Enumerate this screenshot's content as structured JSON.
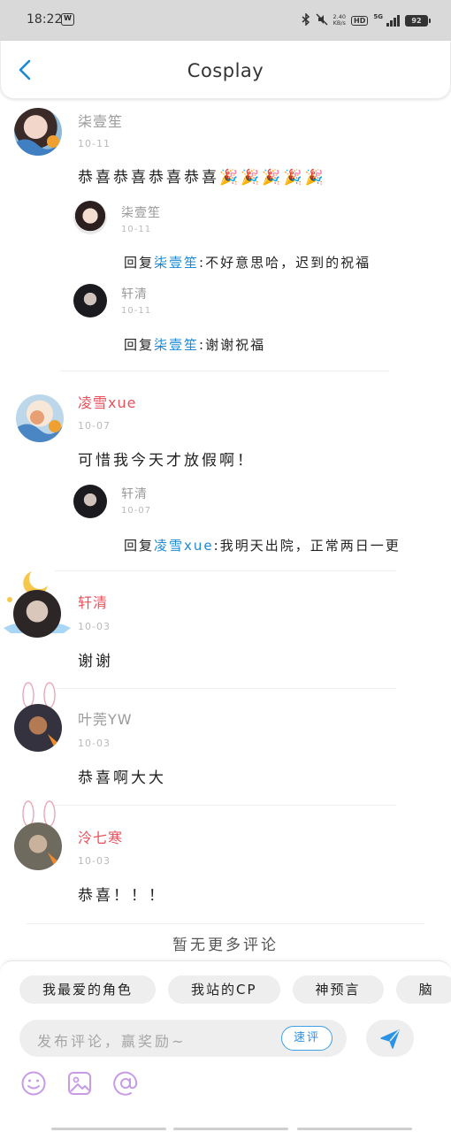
{
  "status_bar": {
    "time": "18:22",
    "app_badge": "W",
    "net_speed_value": "2.40",
    "net_speed_unit": "KB/s",
    "hd": "HD",
    "fiveg": "5G",
    "battery": "92"
  },
  "header": {
    "title": "Cosplay"
  },
  "comments": [
    {
      "name": "柒壹笙",
      "name_color": "gray",
      "date": "10-11",
      "text": "恭喜恭喜恭喜恭喜🎉🎉🎉🎉🎉",
      "replies": [
        {
          "name": "柒壹笙",
          "date": "10-11",
          "prefix": "回复",
          "mention": "柒壹笙",
          "text": ":不好意思哈，迟到的祝福"
        },
        {
          "name": "轩清",
          "date": "10-11",
          "prefix": "回复",
          "mention": "柒壹笙",
          "text": ":谢谢祝福"
        }
      ]
    },
    {
      "name": "凌雪xue",
      "name_color": "red",
      "date": "10-07",
      "text": "可惜我今天才放假啊！",
      "replies": [
        {
          "name": "轩清",
          "date": "10-07",
          "prefix": "回复",
          "mention": "凌雪xue",
          "text": ":我明天出院，正常两日一更"
        }
      ]
    },
    {
      "name": "轩清",
      "name_color": "red",
      "date": "10-03",
      "text": "谢谢",
      "replies": []
    },
    {
      "name": "叶莞YW",
      "name_color": "gray",
      "date": "10-03",
      "text": "恭喜啊大大",
      "replies": []
    },
    {
      "name": "泠七寒",
      "name_color": "red",
      "date": "10-03",
      "text": "恭喜！！！",
      "replies": []
    }
  ],
  "no_more": "暂无更多评论",
  "bottom": {
    "tags": [
      "我最爱的角色",
      "我站的CP",
      "神预言",
      "脑"
    ],
    "input_placeholder": "发布评论，赢奖励~",
    "quick_comment": "速评"
  },
  "colors": {
    "accent": "#1c89d4",
    "name_red": "#e8505b",
    "date_gray": "#b9b9b9"
  }
}
